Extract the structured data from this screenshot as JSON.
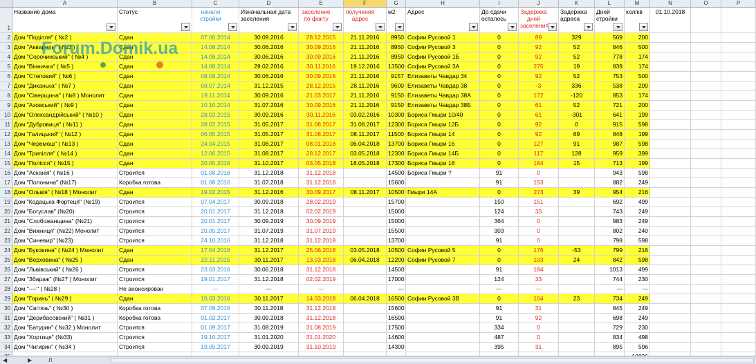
{
  "columns": [
    "A",
    "B",
    "C",
    "D",
    "E",
    "F",
    "G",
    "H",
    "I",
    "J",
    "K",
    "L",
    "M",
    "N",
    "O",
    "P"
  ],
  "headers": [
    {
      "text": "Название дома",
      "color": "",
      "filter": true
    },
    {
      "text": "Статус",
      "color": "",
      "filter": true
    },
    {
      "text": "начало стройки",
      "color": "blue",
      "filter": true
    },
    {
      "text": "Изначальная дата заселения",
      "color": "",
      "filter": true
    },
    {
      "text": "заселение по факту",
      "color": "red",
      "filter": true
    },
    {
      "text": "получения адрес",
      "color": "red",
      "filter": true
    },
    {
      "text": "м2",
      "color": "",
      "filter": true
    },
    {
      "text": "Адрес",
      "color": "",
      "filter": true
    },
    {
      "text": "До сдачи осталось",
      "color": "",
      "filter": true
    },
    {
      "text": "Задержка дней заселения",
      "color": "red",
      "filter": true
    },
    {
      "text": "Задержка адреса",
      "color": "",
      "filter": true
    },
    {
      "text": "Дней стройки",
      "color": "",
      "filter": true
    },
    {
      "text": "кол/кв",
      "color": "",
      "filter": true
    },
    {
      "text": "01.10.2018",
      "color": "",
      "filter": false
    },
    {
      "text": "",
      "color": "",
      "filter": false
    },
    {
      "text": "",
      "color": "",
      "filter": false
    }
  ],
  "rows": [
    {
      "n": 2,
      "y": true,
      "c": [
        "Дом \"Поділля\" ( №2 )",
        "Сдан",
        "07.06.2014",
        "30.09.2016",
        "28.12.2015",
        "21.11.2016",
        "8950",
        "Софии Русовой 1",
        "0",
        "89",
        "329",
        "569",
        "200"
      ]
    },
    {
      "n": 3,
      "y": true,
      "c": [
        "Дом \"Акварель\" ( №3 )",
        "Сдан",
        "14.08.2014",
        "30.06.2016",
        "30.09.2016",
        "21.11.2016",
        "8950",
        "Софии Русовой 3",
        "0",
        "92",
        "52",
        "846",
        "500"
      ]
    },
    {
      "n": 4,
      "y": true,
      "c": [
        "Дом \"Сорочинський\" ( №4 )",
        "Сдан",
        "14.08.2014",
        "30.06.2016",
        "30.09.2016",
        "21.11.2016",
        "8950",
        "Софии Русовой 1Б",
        "0",
        "92",
        "52",
        "778",
        "174"
      ]
    },
    {
      "n": 5,
      "y": true,
      "c": [
        "Дом \"Вінничка\" ( №5 )",
        "Сдан",
        "14.08.2014",
        "29.02.2016",
        "30.11.2016",
        "19.12.2016",
        "13500",
        "Софии Русовой 3А",
        "0",
        "275",
        "19",
        "839",
        "174"
      ]
    },
    {
      "n": 6,
      "y": true,
      "c": [
        "Дом \"Степовий\" ( №6 )",
        "Сдан",
        "08.09.2014",
        "30.06.2016",
        "30.09.2016",
        "21.11.2016",
        "9157",
        "Елизаветы Чавдар 34",
        "0",
        "92",
        "52",
        "753",
        "500"
      ]
    },
    {
      "n": 7,
      "y": true,
      "c": [
        "Дом \"Диканька\" ( №7 )",
        "Сдан",
        "08.07.2014",
        "31.12.2015",
        "28.12.2015",
        "28.11.2016",
        "9600",
        "Елизаветы Чавдар 38",
        "0",
        "-3",
        "336",
        "538",
        "200"
      ]
    },
    {
      "n": 8,
      "y": true,
      "c": [
        "Дом \"Сіверщина\" ( №8 ) Монолит",
        "Сдан",
        "19.11.2014",
        "30.09.2016",
        "21.03.2017",
        "21.11.2016",
        "9150",
        "Елизаветы Чавдар 38А",
        "0",
        "172",
        "-120",
        "853",
        "174"
      ]
    },
    {
      "n": 9,
      "y": true,
      "c": [
        "Дом \"Азовський\" ( №9 )",
        "Сдан",
        "10.10.2014",
        "31.07.2016",
        "30.09.2016",
        "21.11.2016",
        "9150",
        "Елизаветы Чавдар 38Б",
        "0",
        "61",
        "52",
        "721",
        "200"
      ]
    },
    {
      "n": 10,
      "y": true,
      "c": [
        "Дом \"Олександрійський\" ( №10 )",
        "Сдан",
        "28.02.2015",
        "30.09.2016",
        "30.11.2016",
        "03.02.2016",
        "10300",
        "Бориса Гмыри 10/40",
        "0",
        "61",
        "-301",
        "641",
        "199"
      ]
    },
    {
      "n": 11,
      "y": true,
      "c": [
        "Дом \"Дубровиця\" ( №11 )",
        "Сдан",
        "28.02.2015",
        "31.05.2017",
        "31.08.2017",
        "31.08.2017",
        "12300",
        "Бориса Гмыри 12Б",
        "0",
        "92",
        "0",
        "915",
        "598"
      ]
    },
    {
      "n": 12,
      "y": true,
      "c": [
        "Дом \"Галицький\" ( №12 )",
        "Сдан",
        "06.05.2015",
        "31.05.2017",
        "31.08.2017",
        "08.11.2017",
        "11500",
        "Бориса Гмыри 14",
        "0",
        "92",
        "69",
        "848",
        "199"
      ]
    },
    {
      "n": 13,
      "y": true,
      "c": [
        "Дом \"Черемош\" ( №13 )",
        "Сдан",
        "24.04.2015",
        "31.08.2017",
        "08.01.2018",
        "06.04.2018",
        "13700",
        "Бориса Гмыри 16",
        "0",
        "127",
        "91",
        "987",
        "598"
      ]
    },
    {
      "n": 14,
      "y": true,
      "c": [
        "Дом \"Трипілля\" ( №14 )",
        "Сдан",
        "12.06.2015",
        "31.08.2017",
        "28.12.2017",
        "03.05.2018",
        "12300",
        "Бориса Гмыри 14Б",
        "0",
        "117",
        "128",
        "959",
        "399"
      ]
    },
    {
      "n": 15,
      "y": true,
      "c": [
        "Дом \"Полісся\" ( №15 )",
        "Сдан",
        "20.05.2016",
        "31.10.2017",
        "03.05.2018",
        "18.05.2018",
        "17300",
        "Бориса Гмыри 18",
        "0",
        "184",
        "15",
        "713",
        "199"
      ]
    },
    {
      "n": 16,
      "y": false,
      "c": [
        "Дом \"Асканія\" ( №16 )",
        "Строится",
        "01.08.2016",
        "31.12.2018",
        "31.12.2018",
        "",
        "14500",
        "Бориса Гмыри ?",
        "91",
        "0",
        "",
        "943",
        "598"
      ]
    },
    {
      "n": 17,
      "y": false,
      "c": [
        "Дом \"Полонина\" (№17)",
        "Коробка готова",
        "01.08.2016",
        "31.07.2018",
        "31.12.2018",
        "",
        "15600",
        "",
        "91",
        "153",
        "",
        "882",
        "249"
      ]
    },
    {
      "n": 18,
      "y": true,
      "c": [
        "Дом \"Ольвія\" ( №18 ) Монолит",
        "Сдан",
        "19.02.2015",
        "31.12.2016",
        "30.09.2017",
        "08.11.2017",
        "10500",
        "Гмыри 14А",
        "0",
        "273",
        "39",
        "954",
        "216"
      ]
    },
    {
      "n": 19,
      "y": false,
      "c": [
        "Дом \"Кодацька Фортеця\" (№19)",
        "Строится",
        "07.04.2017",
        "30.09.2018",
        "28.02.2019",
        "",
        "15700",
        "",
        "150",
        "151",
        "",
        "692",
        "499"
      ]
    },
    {
      "n": 20,
      "y": false,
      "c": [
        "Дом \"Богуслав\" (№20)",
        "Строится",
        "20.01.2017",
        "31.12.2018",
        "02.02.2019",
        "",
        "15000",
        "",
        "124",
        "33",
        "",
        "743",
        "249"
      ]
    },
    {
      "n": 21,
      "y": false,
      "c": [
        "Дом \"Слобожанщина\" (№21)",
        "Строится",
        "20.01.2017",
        "30.09.2019",
        "30.09.2019",
        "",
        "15000",
        "",
        "364",
        "0",
        "",
        "983",
        "249"
      ]
    },
    {
      "n": 22,
      "y": false,
      "c": [
        "Дом \"Вижниця\" (№22) Монолит",
        "Строится",
        "20.05.2017",
        "31.07.2019",
        "31.07.2019",
        "",
        "15500",
        "",
        "303",
        "0",
        "",
        "802",
        "240"
      ]
    },
    {
      "n": 23,
      "y": false,
      "c": [
        "Дом \"Синевир\" (№23)",
        "Строится",
        "24.10.2016",
        "31.12.2018",
        "31.12.2018",
        "",
        "13700",
        "",
        "91",
        "0",
        "",
        "798",
        "598"
      ]
    },
    {
      "n": 24,
      "y": true,
      "c": [
        "Дом \"Буковина\" ( №24 ) Монолит",
        "Сдан",
        "17.04.2016",
        "31.12.2017",
        "25.06.2018",
        "03.05.2018",
        "10500",
        "Софии Русовой 5",
        "0",
        "176",
        "-53",
        "799",
        "216"
      ]
    },
    {
      "n": 25,
      "y": true,
      "c": [
        "Дом \"Верховина\" ( №25 )",
        "Сдан",
        "22.11.2015",
        "30.11.2017",
        "13.03.2018",
        "06.04.2018",
        "12200",
        "Софии Русовой 7",
        "0",
        "103",
        "24",
        "842",
        "598"
      ]
    },
    {
      "n": 26,
      "y": false,
      "c": [
        "Дом \"Львівський\" ( №26 )",
        "Строится",
        "23.03.2016",
        "30.06.2018",
        "31.12.2018",
        "",
        "14500",
        "",
        "91",
        "184",
        "",
        "1013",
        "499"
      ]
    },
    {
      "n": 27,
      "y": false,
      "c": [
        "Дом \"Збараж\" (№27 ) Монолит",
        "Строится",
        "19.01.2017",
        "31.12.2018",
        "02.02.2019",
        "",
        "17000",
        "",
        "124",
        "33",
        "",
        "744",
        "230"
      ]
    },
    {
      "n": 28,
      "y": false,
      "c": [
        "Дом \"----\" ( №28 )",
        "Не анонсирован",
        "---",
        "---",
        "---",
        "",
        "---",
        "",
        "---",
        "---",
        "",
        "---",
        "---"
      ]
    },
    {
      "n": 29,
      "y": true,
      "c": [
        "Дом \"Горинь\" ( №29 )",
        "Сдан",
        "10.03.2016",
        "30.11.2017",
        "14.03.2018",
        "06.04.2018",
        "16500",
        "Софии Русовой 3В",
        "0",
        "104",
        "23",
        "734",
        "249"
      ]
    },
    {
      "n": 30,
      "y": false,
      "c": [
        "Дом \"Світязь\" ( №30 )",
        "Коробка готова",
        "07.09.2016",
        "30.11.2018",
        "31.12.2018",
        "",
        "15600",
        "",
        "91",
        "31",
        "",
        "845",
        "249"
      ]
    },
    {
      "n": 31,
      "y": false,
      "c": [
        "Дом \"Дерибасовский\" ( №31 )",
        "Коробка готова",
        "01.02.2017",
        "30.09.2018",
        "31.12.2018",
        "",
        "16500",
        "",
        "91",
        "92",
        "",
        "698",
        "249"
      ]
    },
    {
      "n": 32,
      "y": false,
      "c": [
        "Дом \"Батурин\" ( №32 ) Монолит",
        "Строится",
        "01.09.2017",
        "31.08.2019",
        "31.08.2019",
        "",
        "17500",
        "",
        "334",
        "0",
        "",
        "729",
        "230"
      ]
    },
    {
      "n": 33,
      "y": false,
      "c": [
        "Дом \"Хортиця\" (№33)",
        "Строится",
        "19.10.2017",
        "31.01.2020",
        "31.01.2020",
        "",
        "14600",
        "",
        "487",
        "0",
        "",
        "834",
        "498"
      ]
    },
    {
      "n": 34,
      "y": false,
      "c": [
        "Дом \"Чигирин\" ( №34 )",
        "Строится",
        "19.05.2017",
        "30.09.2019",
        "31.10.2019",
        "",
        "14300",
        "",
        "395",
        "31",
        "",
        "895",
        "596"
      ]
    },
    {
      "n": 35,
      "y": false,
      "c": [
        "",
        "",
        "",
        "",
        "",
        "",
        "",
        "",
        "",
        "",
        "",
        "",
        "10826"
      ]
    }
  ],
  "watermark": "Forum.Domik.ua",
  "sheet_tab": "Л"
}
